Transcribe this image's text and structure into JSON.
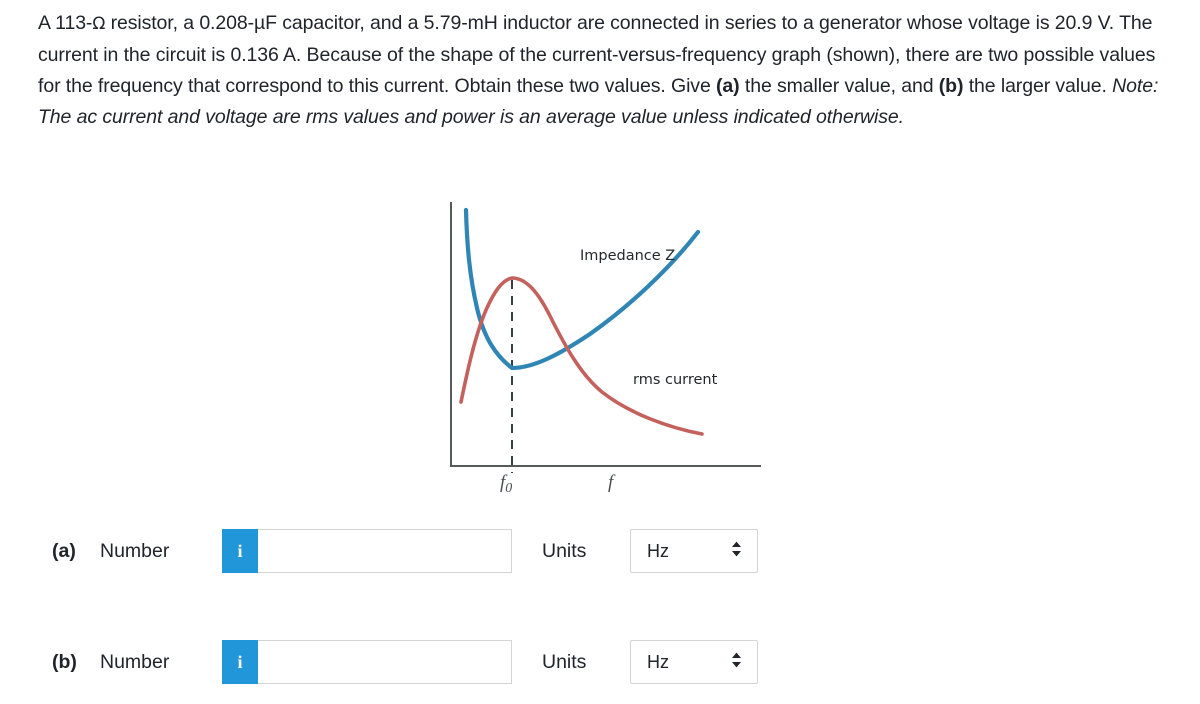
{
  "question": {
    "seg1": "A 113-",
    "ohm": "Ω",
    "seg2": " resistor, a 0.208-µF capacitor, and a 5.79-mH inductor are connected in series to a generator whose voltage is 20.9 V. The current in the circuit is 0.136 A. Because of the shape of the current-versus-frequency graph (shown), there are two possible values for the frequency that correspond to this current. Obtain these two values. Give ",
    "bold_a": "(a)",
    "seg3": " the smaller value, and ",
    "bold_b": "(b)",
    "seg4": " the larger value. ",
    "note": "Note: The ac current and voltage are rms values and power is an average value unless indicated otherwise."
  },
  "figure": {
    "impedance_label": "Impedance Z",
    "current_label": "rms current",
    "x_tick_label": "f",
    "x_tick_sub": "0",
    "x_axis_label": "f",
    "impedance_color": "#2f86b5",
    "current_color": "#c4615c",
    "axis_color": "#555a5f",
    "dash_color": "#3a3f44"
  },
  "answers": [
    {
      "part": "(a)",
      "number_label": "Number",
      "info_icon": "i",
      "input_value": "",
      "input_placeholder": "",
      "units_label": "Units",
      "unit_value": "Hz",
      "unit_options": [
        "Hz"
      ],
      "updown_icon": "⇅"
    },
    {
      "part": "(b)",
      "number_label": "Number",
      "info_icon": "i",
      "input_value": "",
      "input_placeholder": "",
      "units_label": "Units",
      "unit_value": "Hz",
      "unit_options": [
        "Hz"
      ],
      "updown_icon": "⇅"
    }
  ],
  "chart_data": {
    "type": "line",
    "title": "",
    "xlabel": "f",
    "ylabel": "",
    "grid": false,
    "legend": "inline-annotations",
    "annotations": [
      {
        "text": "Impedance Z",
        "x": 0.42,
        "y": 0.84
      },
      {
        "text": "rms current",
        "x": 0.63,
        "y": 0.44
      }
    ],
    "x_ticks": [
      {
        "value": 0.2,
        "label": "f0"
      },
      {
        "value": 0.52,
        "label": "f"
      }
    ],
    "vertical_dashed_line_at": "f0",
    "series": [
      {
        "name": "Impedance Z",
        "color": "#2f86b5",
        "x": [
          0.05,
          0.07,
          0.1,
          0.14,
          0.2,
          0.28,
          0.4,
          0.55,
          0.72,
          0.9,
          1.0
        ],
        "y": [
          0.97,
          0.78,
          0.55,
          0.35,
          0.2,
          0.26,
          0.38,
          0.55,
          0.74,
          0.92,
          1.0
        ]
      },
      {
        "name": "rms current",
        "color": "#c4615c",
        "x": [
          0.02,
          0.06,
          0.11,
          0.16,
          0.2,
          0.27,
          0.36,
          0.48,
          0.62,
          0.8,
          1.0
        ],
        "y": [
          0.05,
          0.28,
          0.55,
          0.74,
          0.79,
          0.68,
          0.52,
          0.38,
          0.27,
          0.18,
          0.12
        ]
      }
    ]
  }
}
